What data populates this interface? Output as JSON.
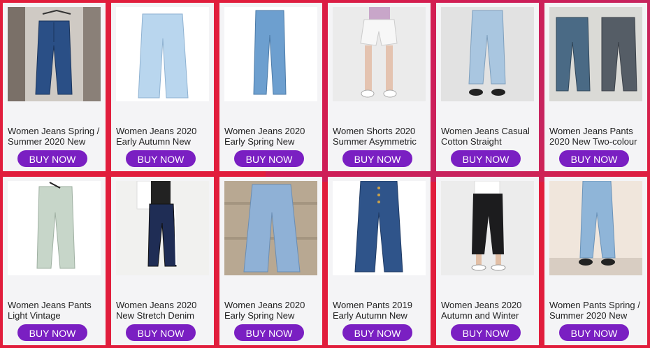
{
  "button_label": "BUY NOW",
  "products": [
    {
      "title": "Women Jeans Spring / Summer 2020 New",
      "image": "model-hanger-jeans"
    },
    {
      "title": "Women Jeans 2020 Early Autumn New",
      "image": "light-wide-jeans"
    },
    {
      "title": "Women Jeans 2020 Early Spring New",
      "image": "straight-light-jeans"
    },
    {
      "title": "Women Shorts 2020 Summer Asymmetric",
      "image": "white-denim-shorts"
    },
    {
      "title": "Women Jeans Casual Cotton Straight",
      "image": "light-straight-model"
    },
    {
      "title": "Women Jeans Pants 2020 New Two-colour",
      "image": "two-tone-jeans-models"
    },
    {
      "title": "Women Jeans Pants Light Vintage",
      "image": "ripped-vintage-jeans"
    },
    {
      "title": "Women Jeans 2020 New Stretch Denim",
      "image": "stretch-denim-model"
    },
    {
      "title": "Women Jeans 2020 Early Spring New",
      "image": "bootcut-flat-jeans"
    },
    {
      "title": "Women Pants 2019 Early Autumn New",
      "image": "cropped-flare-jeans"
    },
    {
      "title": "Women Jeans 2020 Autumn and Winter",
      "image": "black-cropped-jeans"
    },
    {
      "title": "Women Pants Spring / Summer 2020 New",
      "image": "light-tapered-jeans"
    }
  ],
  "colors": {
    "background": "#e11d3c",
    "card": "#f4f4f6",
    "button": "#7a1fc2",
    "button_text": "#ffffff"
  }
}
